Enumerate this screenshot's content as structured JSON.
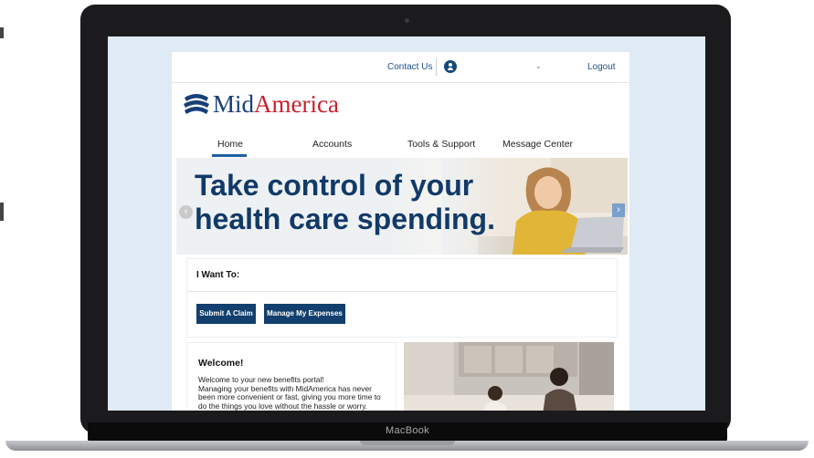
{
  "device": {
    "brand_label": "MacBook"
  },
  "header": {
    "contact_label": "Contact Us",
    "logout_label": "Logout"
  },
  "logo": {
    "text_mid": "Mid",
    "text_america": "America"
  },
  "nav": {
    "items": [
      {
        "label": "Home",
        "active": true
      },
      {
        "label": "Accounts"
      },
      {
        "label": "Tools & Support"
      },
      {
        "label": "Message Center"
      }
    ]
  },
  "hero": {
    "line1": "Take control of your",
    "line2": "health care spending."
  },
  "i_want_to": {
    "title": "I Want To:",
    "buttons": [
      "Submit A Claim",
      "Manage My Expenses"
    ]
  },
  "welcome": {
    "title": "Welcome!",
    "line1": "Welcome to your new benefits portal!",
    "line2": "Managing your benefits with MidAmerica has never",
    "line3": "been more convenient or fast, giving you more time to",
    "line4": "do the things you love without the hassle or worry."
  },
  "colors": {
    "brand_navy": "#123a68",
    "brand_red": "#c8202f",
    "screen_bg": "#dfeaf4"
  },
  "icons": [
    "user-icon",
    "chevron-down-icon",
    "chevron-left-icon",
    "chevron-right-icon",
    "midamerica-logo-icon"
  ]
}
